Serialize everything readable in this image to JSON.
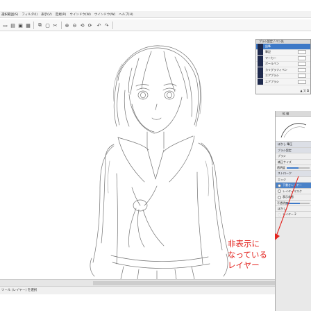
{
  "menubar": {
    "items": [
      "選択範囲(S)",
      "フィルタ(I)",
      "表示(V)",
      "定規(R)",
      "ウインドウ(W)",
      "ウインドウ(W)",
      "ヘルプ(H)"
    ]
  },
  "toolbar": {
    "icons": [
      "new-file-icon",
      "open-file-icon",
      "save-icon",
      "print-icon",
      "copy-icon",
      "paste-icon",
      "cut-icon",
      "zoom-in-icon",
      "zoom-out-icon",
      "rotate-left-icon",
      "rotate-right-icon",
      "undo-icon",
      "redo-icon"
    ]
  },
  "brush_panel": {
    "title": "ブラシ設定 / ペン先",
    "items": [
      {
        "label": "鉛筆",
        "selected": true
      },
      {
        "label": "筆記",
        "selected": false
      },
      {
        "label": "マーカー",
        "selected": false
      },
      {
        "label": "ボールペン",
        "selected": false
      },
      {
        "label": "カリグラフィペン",
        "selected": false
      },
      {
        "label": "エアブラシ",
        "selected": false
      },
      {
        "label": "エアブラシ",
        "selected": false
      }
    ],
    "footer": "▲ 又 ⧉"
  },
  "dock": {
    "header": "拡 縮",
    "rows": [
      {
        "label": "ぼかし 筆圧",
        "type": "group"
      },
      {
        "label": "ブラシ設定",
        "type": "group"
      },
      {
        "label": "ブラシ",
        "type": "normal"
      },
      {
        "label": "補正サイズ",
        "type": "normal"
      },
      {
        "label": "透明度",
        "type": "slider",
        "value": 0.5
      },
      {
        "label": "ストローク",
        "type": "group"
      },
      {
        "label": "エッジ",
        "type": "normal"
      },
      {
        "label": "下書きレイヤー",
        "type": "selected"
      },
      {
        "label": "レイヤーマスク",
        "type": "normal"
      },
      {
        "label": "表示状態",
        "type": "normal"
      },
      {
        "label": "不透明度",
        "type": "slider",
        "value": 0.55
      },
      {
        "label": "ぼかし",
        "type": "normal"
      },
      {
        "label": "レイヤー 2",
        "type": "hidden-layer"
      }
    ]
  },
  "annotation": {
    "lines": [
      "非表示に",
      "なっている",
      "レイヤー"
    ],
    "color": "#e3241f"
  },
  "statusbar": {
    "text": "ツール (レイヤー) を選択"
  },
  "colors": {
    "accent": "#3d79c7",
    "brush_icon": "#1f2a4d",
    "annotation": "#e3241f"
  }
}
